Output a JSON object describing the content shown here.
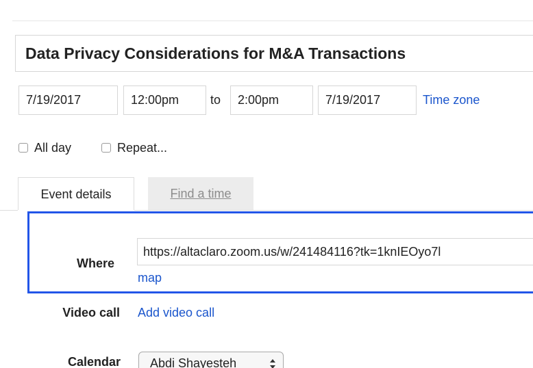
{
  "event": {
    "title": "Data Privacy Considerations for M&A Transactions"
  },
  "datetime": {
    "start_date": "7/19/2017",
    "start_time": "12:00pm",
    "to_label": "to",
    "end_time": "2:00pm",
    "end_date": "7/19/2017",
    "timezone_link": "Time zone"
  },
  "options": {
    "all_day_label": "All day",
    "all_day_checked": false,
    "repeat_label": "Repeat...",
    "repeat_checked": false
  },
  "tabs": [
    {
      "label": "Event details",
      "active": true
    },
    {
      "label": "Find a time",
      "active": false
    }
  ],
  "details": {
    "where_label": "Where",
    "where_value": "https://altaclaro.zoom.us/w/241484116?tk=1knIEOyo7l",
    "map_link": "map",
    "videocall_label": "Video call",
    "videocall_link": "Add video call",
    "calendar_label": "Calendar",
    "calendar_value": "Abdi Shayesteh"
  },
  "colors": {
    "link": "#1a55cc",
    "focus_border": "#2255e8"
  }
}
